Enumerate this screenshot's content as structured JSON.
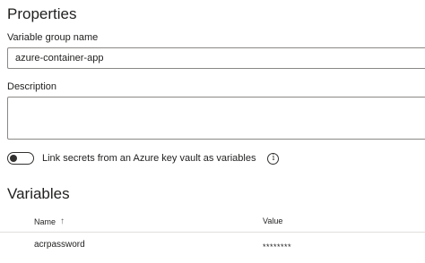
{
  "properties": {
    "title": "Properties",
    "name_label": "Variable group name",
    "name_value": "azure-container-app",
    "description_label": "Description",
    "description_value": "",
    "link_secrets_label": "Link secrets from an Azure key vault as variables",
    "link_secrets_enabled": false,
    "info_icon": "info-icon"
  },
  "variables": {
    "title": "Variables",
    "columns": {
      "name": "Name",
      "sort_indicator": "↑",
      "value": "Value"
    },
    "rows": [
      {
        "name": "acrpassword",
        "value": "********"
      }
    ]
  },
  "colors": {
    "border": "#8a8886",
    "text": "#201f1e",
    "divider": "#e1dfdd"
  }
}
